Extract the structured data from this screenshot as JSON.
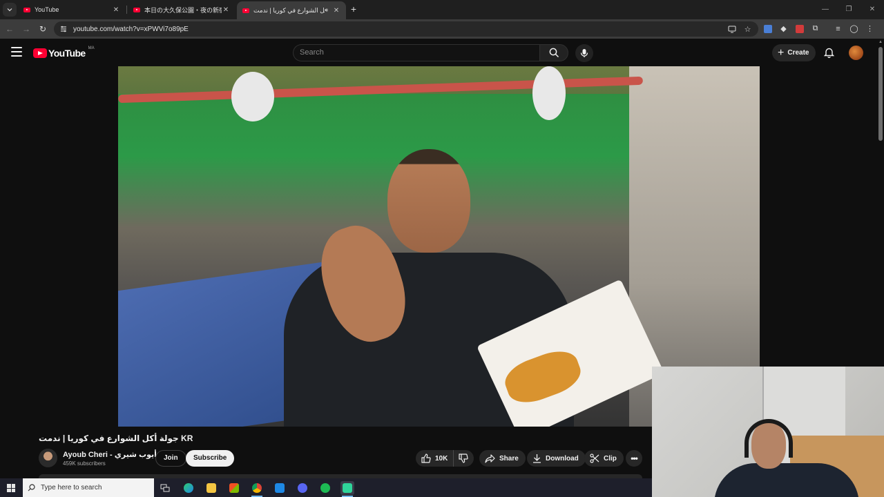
{
  "browser": {
    "tabs": [
      {
        "label": "YouTube"
      },
      {
        "label": "本日の大久保公園・夜の新宿歌舞伎町"
      },
      {
        "label": "جولة أكل الشوارع في كوريا | ندمت KR"
      }
    ],
    "url": "youtube.com/watch?v=xPWVi7o89pE"
  },
  "youtube": {
    "logo_text": "YouTube",
    "country_code": "MA",
    "search_placeholder": "Search",
    "create_label": "Create"
  },
  "video": {
    "title": "جولة أكل الشوارع في كوريا | ندمت KR",
    "channel_name": "Ayoub Cheri - أيوب شيري",
    "subscribers": "459K subscribers",
    "join_label": "Join",
    "subscribe_label": "Subscribe",
    "likes": "10K",
    "share_label": "Share",
    "download_label": "Download",
    "clip_label": "Clip"
  },
  "taskbar": {
    "search_placeholder": "Type here to search",
    "apps": [
      "task-view",
      "edge",
      "file-explorer",
      "store",
      "chrome",
      "mail",
      "discord",
      "spotify",
      "obs"
    ]
  },
  "colors": {
    "youtube_red": "#ff0033",
    "background": "#0f0f0f",
    "pill_bg": "#272727",
    "subscribe_bg": "#f1f1f1"
  }
}
